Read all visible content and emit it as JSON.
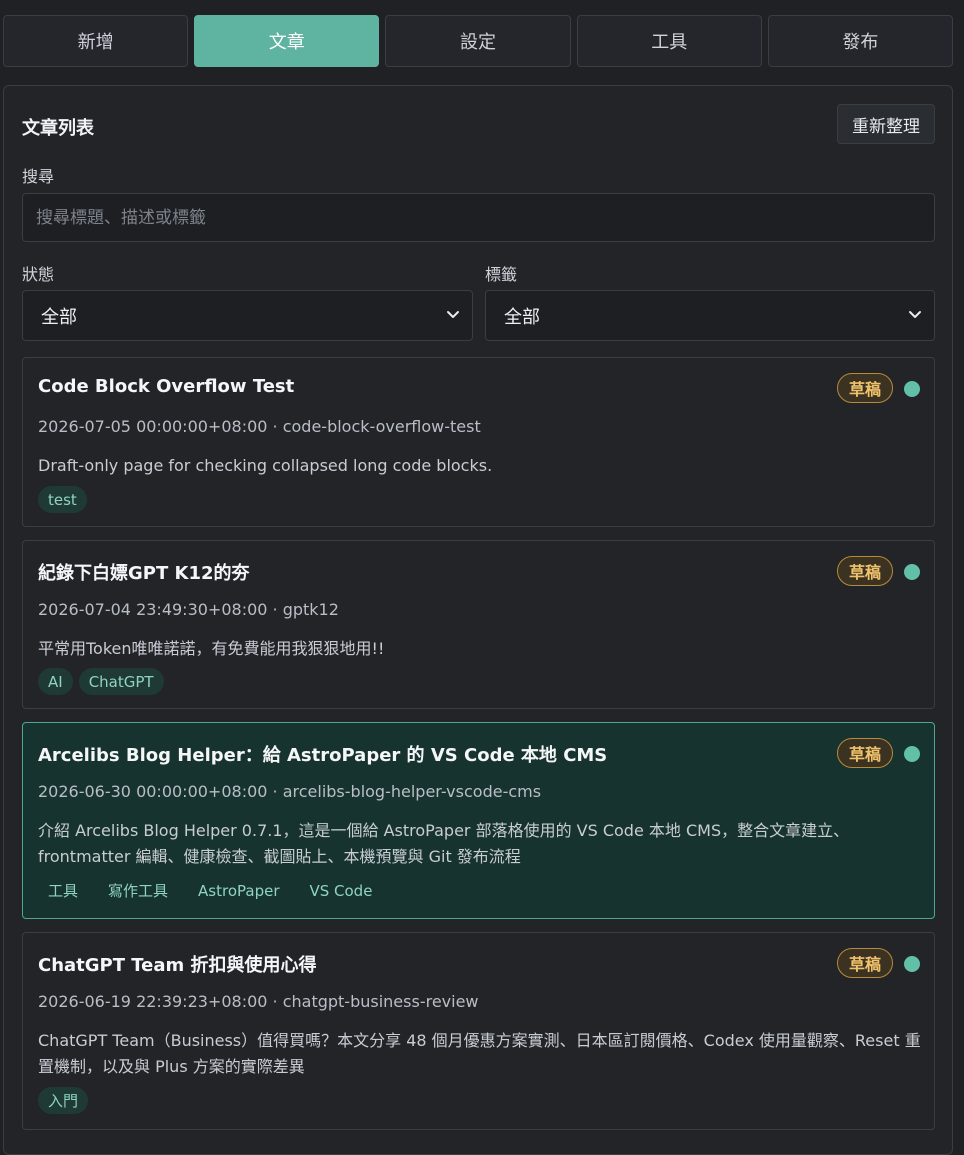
{
  "tabs": [
    {
      "label": "新增",
      "active": false
    },
    {
      "label": "文章",
      "active": true
    },
    {
      "label": "設定",
      "active": false
    },
    {
      "label": "工具",
      "active": false
    },
    {
      "label": "發布",
      "active": false
    }
  ],
  "panel": {
    "title": "文章列表",
    "refresh_label": "重新整理"
  },
  "search": {
    "label": "搜尋",
    "placeholder": "搜尋標題、描述或標籤",
    "value": ""
  },
  "filters": {
    "status_label": "狀態",
    "status_value": "全部",
    "tag_label": "標籤",
    "tag_value": "全部"
  },
  "posts": [
    {
      "title": "Code Block Overflow Test",
      "status": "草稿",
      "meta": "2026-07-05 00:00:00+08:00 · code-block-overflow-test",
      "description": "Draft-only page for checking collapsed long code blocks.",
      "tags": [
        "test"
      ],
      "selected": false
    },
    {
      "title": "紀錄下白嫖GPT K12的夯",
      "status": "草稿",
      "meta": "2026-07-04 23:49:30+08:00 · gptk12",
      "description": "平常用Token唯唯諾諾，有免費能用我狠狠地用!!",
      "tags": [
        "AI",
        "ChatGPT"
      ],
      "selected": false
    },
    {
      "title": "Arcelibs Blog Helper：給 AstroPaper 的 VS Code 本地 CMS",
      "status": "草稿",
      "meta": "2026-06-30 00:00:00+08:00 · arcelibs-blog-helper-vscode-cms",
      "description": "介紹 Arcelibs Blog Helper 0.7.1，這是一個給 AstroPaper 部落格使用的 VS Code 本地 CMS，整合文章建立、frontmatter 編輯、健康檢查、截圖貼上、本機預覽與 Git 發布流程",
      "tags": [
        "工具",
        "寫作工具",
        "AstroPaper",
        "VS Code"
      ],
      "selected": true
    },
    {
      "title": "ChatGPT Team 折扣與使用心得",
      "status": "草稿",
      "meta": "2026-06-19 22:39:23+08:00 · chatgpt-business-review",
      "description": "ChatGPT Team（Business）值得買嗎？本文分享 48 個月優惠方案實測、日本區訂閱價格、Codex 使用量觀察、Reset 重置機制，以及與 Plus 方案的實際差異",
      "tags": [
        "入門"
      ],
      "selected": false
    }
  ],
  "colors": {
    "accent": "#5fb3a1",
    "draft_badge": "#f0c36b",
    "status_dot": "#62c0a8",
    "selected_card_bg": "#17332f"
  }
}
